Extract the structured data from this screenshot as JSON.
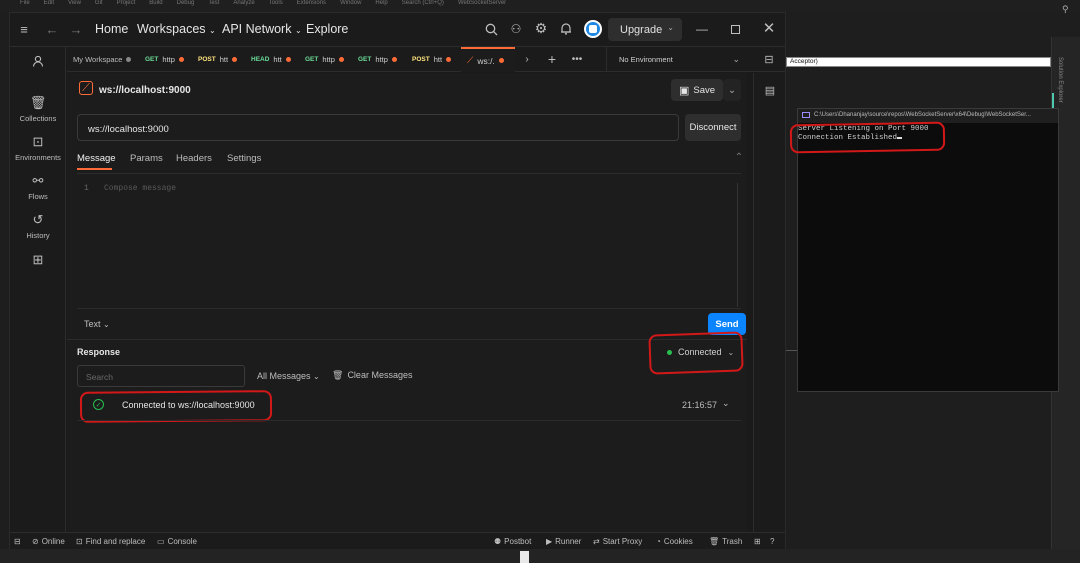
{
  "desktop": {
    "vs_menu": [
      "File",
      "Edit",
      "View",
      "Git",
      "Project",
      "Build",
      "Debug",
      "Test",
      "Analyze",
      "Tools",
      "Extensions",
      "Window",
      "Help",
      "Search (Ctrl+Q)",
      "WebSocketServer"
    ],
    "acceptor_label": "Acceptor)",
    "solution_explorer": "Solution Explorer"
  },
  "titlebar": {
    "home": "Home",
    "workspaces": "Workspaces",
    "api_network": "API Network",
    "explore": "Explore",
    "upgrade": "Upgrade"
  },
  "sidebar": {
    "items": [
      {
        "label": "Collections"
      },
      {
        "label": "Environments"
      },
      {
        "label": "Flows"
      },
      {
        "label": "History"
      }
    ]
  },
  "tabs": {
    "workspace": "My Workspace",
    "items": [
      {
        "method": "GET",
        "name": "http",
        "color": "#6bdd9a"
      },
      {
        "method": "POST",
        "name": "htt",
        "color": "#ffe47e"
      },
      {
        "method": "HEAD",
        "name": "htt",
        "color": "#6bdd9a"
      },
      {
        "method": "GET",
        "name": "http",
        "color": "#6bdd9a"
      },
      {
        "method": "GET",
        "name": "http",
        "color": "#6bdd9a"
      },
      {
        "method": "POST",
        "name": "htt",
        "color": "#ffe47e"
      },
      {
        "method": "",
        "name": "ws:/.",
        "color": "#ff6c37"
      }
    ],
    "environment": "No Environment"
  },
  "request": {
    "title": "ws://localhost:9000",
    "save": "Save",
    "url": "ws://localhost:9000",
    "disconnect": "Disconnect",
    "tabs": [
      "Message",
      "Params",
      "Headers",
      "Settings"
    ],
    "line_number": "1",
    "compose_placeholder": "Compose message",
    "format": "Text",
    "send": "Send"
  },
  "response": {
    "heading": "Response",
    "status": "Connected",
    "search_placeholder": "Search",
    "filter": "All Messages",
    "clear": "Clear Messages",
    "message": "Connected to ws://localhost:9000",
    "time": "21:16:57"
  },
  "statusbar": {
    "online": "Online",
    "find_replace": "Find and replace",
    "console": "Console",
    "postbot": "Postbot",
    "runner": "Runner",
    "start_proxy": "Start Proxy",
    "cookies": "Cookies",
    "trash": "Trash"
  },
  "console_window": {
    "title": "C:\\Users\\Dhananjay\\source\\repos\\WebSocketServer\\x64\\Debug\\WebSocketSer...",
    "lines": [
      "Server Listening on Port 9000",
      "Connection Established"
    ]
  },
  "colors": {
    "accent": "#ff6c37",
    "send_blue": "#0b84ff",
    "connected_green": "#29bf4f",
    "annotation_red": "#d21818"
  }
}
